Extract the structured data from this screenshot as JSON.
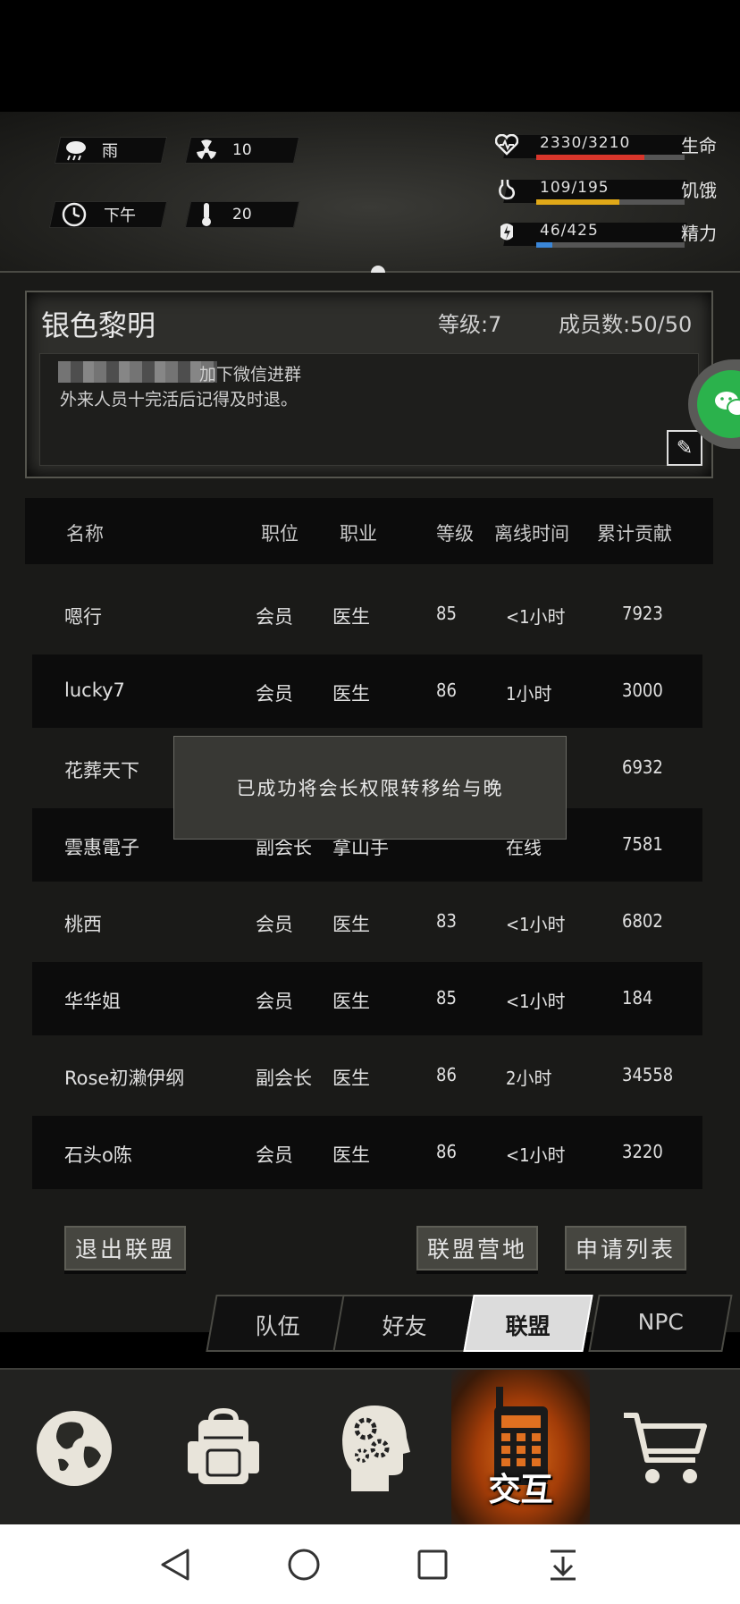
{
  "hud": {
    "weather": "雨",
    "weather_icon": "rain-cloud-icon",
    "radiation": "10",
    "radiation_icon": "radiation-icon",
    "time_of_day": "下午",
    "time_icon": "clock-icon",
    "temperature": "20",
    "temperature_icon": "thermometer-icon",
    "stats": [
      {
        "icon": "heart-icon",
        "value": "2330/3210",
        "label": "生命",
        "fraction": 0.726,
        "color": "#d9362b"
      },
      {
        "icon": "stomach-icon",
        "value": "109/195",
        "label": "饥饿",
        "fraction": 0.559,
        "color": "#e0a818"
      },
      {
        "icon": "energy-icon",
        "value": "46/425",
        "label": "精力",
        "fraction": 0.108,
        "color": "#3a86d8"
      }
    ]
  },
  "guild": {
    "name": "银色黎明",
    "level": "等级:7",
    "members": "成员数:50/50",
    "notice_line1": "加下微信进群",
    "notice_line2": "外来人员十完活后记得及时退。"
  },
  "table": {
    "headers": [
      "名称",
      "职位",
      "职业",
      "等级",
      "离线时间",
      "累计贡献"
    ],
    "rows": [
      {
        "name": "嗯行",
        "role": "会员",
        "job": "医生",
        "level": "85",
        "offline": "<1小时",
        "contrib": "7923"
      },
      {
        "name": "lucky7",
        "role": "会员",
        "job": "医生",
        "level": "86",
        "offline": "1小时",
        "contrib": "3000"
      },
      {
        "name": "花葬天下",
        "role": "",
        "job": "",
        "level": "",
        "offline": "",
        "contrib": "6932"
      },
      {
        "name": "雲惠電子",
        "role": "副会长",
        "job": "拿山手",
        "level": "",
        "offline": "在线",
        "contrib": "7581"
      },
      {
        "name": "桃西",
        "role": "会员",
        "job": "医生",
        "level": "83",
        "offline": "<1小时",
        "contrib": "6802"
      },
      {
        "name": "华华姐",
        "role": "会员",
        "job": "医生",
        "level": "85",
        "offline": "<1小时",
        "contrib": "184"
      },
      {
        "name": "Rose初濑伊纲",
        "role": "副会长",
        "job": "医生",
        "level": "86",
        "offline": "2小时",
        "contrib": "34558"
      },
      {
        "name": "石头o陈",
        "role": "会员",
        "job": "医生",
        "level": "86",
        "offline": "<1小时",
        "contrib": "3220"
      }
    ]
  },
  "toast": "已成功将会长权限转移给与晚",
  "buttons": {
    "leave": "退出联盟",
    "camp": "联盟营地",
    "applications": "申请列表"
  },
  "tabs": [
    "队伍",
    "好友",
    "联盟",
    "NPC"
  ],
  "active_tab": "联盟",
  "bottom_nav": {
    "items": [
      "globe-icon",
      "backpack-icon",
      "head-gears-icon",
      "walkie-talkie-icon",
      "shopping-cart-icon"
    ],
    "active_label": "交互"
  }
}
